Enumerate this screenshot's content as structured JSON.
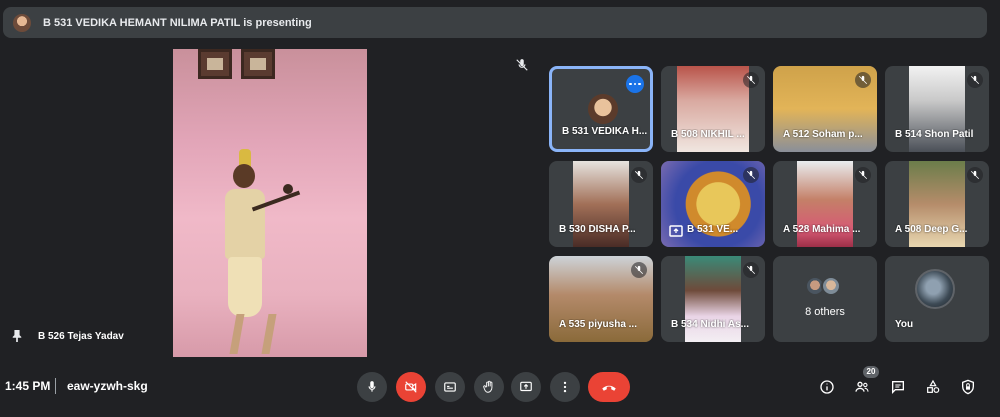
{
  "presenting_banner": {
    "text": "B 531 VEDIKA HEMANT NILIMA PATIL is presenting"
  },
  "main_stage": {
    "pinned_name": "B 526 Tejas Yadav"
  },
  "participants": [
    {
      "name": "B 531 VEDIKA H...",
      "muted": false,
      "speaking": true
    },
    {
      "name": "B 508 NIKHIL ...",
      "muted": true
    },
    {
      "name": "A 512 Soham p...",
      "muted": true
    },
    {
      "name": "B 514 Shon Patil",
      "muted": true
    },
    {
      "name": "B 530 DISHA P...",
      "muted": true
    },
    {
      "name": "B 531 VE...",
      "muted": true,
      "presenting": true
    },
    {
      "name": "A 528 Mahima ...",
      "muted": true
    },
    {
      "name": "A 508 Deep G...",
      "muted": true
    },
    {
      "name": "A 535 piyusha ...",
      "muted": true
    },
    {
      "name": "B 534 Nidhi As...",
      "muted": true
    }
  ],
  "others": {
    "label": "8 others"
  },
  "self": {
    "label": "You"
  },
  "bottom_bar": {
    "time": "1:45 PM",
    "meeting_code": "eaw-yzwh-skg",
    "participant_count": "20"
  },
  "colors": {
    "background": "#202124",
    "tile": "#3c4043",
    "danger": "#ea4335",
    "accent": "#8ab4f8"
  }
}
